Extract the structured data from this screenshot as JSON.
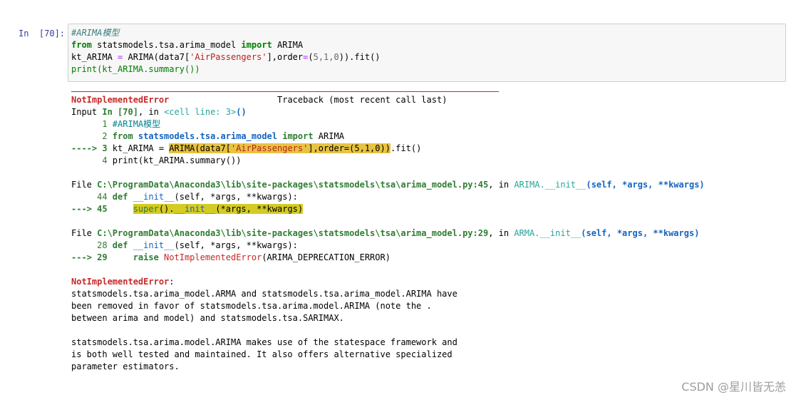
{
  "prompt": "In  [70]:",
  "code": {
    "line1": "#ARIMA模型",
    "line2_kw1": "from",
    "line2_mod": " statsmodels.tsa.arima_model ",
    "line2_kw2": "import",
    "line2_name": " ARIMA",
    "line3_a": "kt_ARIMA ",
    "line3_eq": "=",
    "line3_b": " ARIMA(data7[",
    "line3_str": "'AirPassengers'",
    "line3_c": "],order",
    "line3_eq2": "=",
    "line3_d": "(",
    "line3_nums": "5,1,0",
    "line3_e": ")).fit()",
    "line4": "print(kt_ARIMA.summary())"
  },
  "traceback": {
    "error_name": "NotImplementedError",
    "header_right": "Traceback (most recent call last)",
    "input_label": "Input ",
    "input_in": "In [70]",
    "input_comma": ", in ",
    "cell_line": "<cell line: 3>",
    "cell_paren": "()",
    "f1_l1_num": "      1 ",
    "f1_l1_txt": "#ARIMA模型",
    "f1_l2_num": "      2 ",
    "f1_l2_kw": "from",
    "f1_l2_mod": " statsmodels.tsa.arima_model ",
    "f1_l2_kw2": "import",
    "f1_l2_name": " ARIMA",
    "f1_l3_arrow": "----> 3 ",
    "f1_l3_a": "kt_ARIMA = ",
    "f1_l3_hl1": "ARIMA(data7[",
    "f1_l3_hlstr": "'AirPassengers'",
    "f1_l3_hl2": "],order=(5,1,0))",
    "f1_l3_b": ".fit()",
    "f1_l4_num": "      4 ",
    "f1_l4_txt": "print(kt_ARIMA.summary())",
    "file1_label": "File ",
    "file1_path": "C:\\ProgramData\\Anaconda3\\lib\\site-packages\\statsmodels\\tsa\\arima_model.py:45",
    "file1_in": ", in ",
    "file1_cls": "ARIMA.",
    "file1_fn": "__init__",
    "file1_args": "(self, *args, **kwargs)",
    "f2_l44_num": "     44 ",
    "f2_l44_def": "def",
    "f2_l44_fn": " __init__",
    "f2_l44_args": "(self, *args, **kwargs):",
    "f2_l45_arrow": "---> 45 ",
    "f2_l45_indent": "    ",
    "f2_l45_super": "super",
    "f2_l45_a": "().",
    "f2_l45_init": "__init__",
    "f2_l45_b": "(*args, **kwargs)",
    "file2_label": "File ",
    "file2_path": "C:\\ProgramData\\Anaconda3\\lib\\site-packages\\statsmodels\\tsa\\arima_model.py:29",
    "file2_in": ", in ",
    "file2_cls": "ARMA.",
    "file2_fn": "__init__",
    "file2_args": "(self, *args, **kwargs)",
    "f3_l28_num": "     28 ",
    "f3_l28_def": "def",
    "f3_l28_fn": " __init__",
    "f3_l28_args": "(self, *args, **kwargs):",
    "f3_l29_arrow": "---> 29 ",
    "f3_l29_indent": "    ",
    "f3_l29_raise": "raise",
    "f3_l29_err": " NotImplementedError",
    "f3_l29_arg": "(ARIMA_DEPRECATION_ERROR)",
    "final_error": "NotImplementedError",
    "final_colon": ":",
    "msg1": "statsmodels.tsa.arima_model.ARMA and statsmodels.tsa.arima_model.ARIMA have",
    "msg2": "been removed in favor of statsmodels.tsa.arima.model.ARIMA (note the .",
    "msg3": "between arima and model) and statsmodels.tsa.SARIMAX.",
    "msg4": "statsmodels.tsa.arima.model.ARIMA makes use of the statespace framework and",
    "msg5": "is both well tested and maintained. It also offers alternative specialized",
    "msg6": "parameter estimators."
  },
  "watermark": "CSDN @星川皆无恙"
}
